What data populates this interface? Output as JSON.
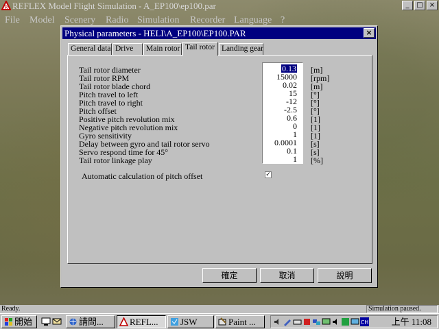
{
  "app": {
    "title": "REFLEX Model Flight Simulation - A_EP100\\ep100.par",
    "menu": [
      "File",
      "Model",
      "Scenery",
      "Radio",
      "Simulation",
      "Recorder",
      "Language",
      "?"
    ],
    "controls": {
      "minimize": "_",
      "maximize": "□",
      "close": "×"
    }
  },
  "dialog": {
    "title": "Physical parameters - HELI\\A_EP100\\EP100.PAR",
    "close": "×",
    "tabs": [
      "General data",
      "Drive",
      "Main rotor",
      "Tail rotor",
      "Landing gear"
    ],
    "active_tab": "Tail rotor",
    "parameters": [
      {
        "label": "Tail rotor diameter",
        "value": "0.13",
        "unit": "[m]",
        "selected": true
      },
      {
        "label": "Tail rotor RPM",
        "value": "15000",
        "unit": "[rpm]"
      },
      {
        "label": "Tail rotor blade chord",
        "value": "0.02",
        "unit": "[m]"
      },
      {
        "label": "Pitch travel to left",
        "value": "15",
        "unit": "[°]"
      },
      {
        "label": "Pitch travel to right",
        "value": "-12",
        "unit": "[°]"
      },
      {
        "label": "Pitch offset",
        "value": "-2.5",
        "unit": "[°]"
      },
      {
        "label": "Positive pitch revolution mix",
        "value": "0.6",
        "unit": "[1]"
      },
      {
        "label": "Negative pitch revolution mix",
        "value": "0",
        "unit": "[1]"
      },
      {
        "label": "Gyro sensitivity",
        "value": "1",
        "unit": "[1]"
      },
      {
        "label": "Delay between gyro and tail rotor servo",
        "value": "0.0001",
        "unit": "[s]"
      },
      {
        "label": "Servo respond time for 45°",
        "value": "0.1",
        "unit": "[s]"
      },
      {
        "label": "Tail rotor linkage play",
        "value": "1",
        "unit": "[%]"
      }
    ],
    "auto_calc": {
      "label": "Automatic calculation of pitch offset",
      "checked": true,
      "mark": "✓"
    },
    "buttons": {
      "ok": "確定",
      "cancel": "取消",
      "help": "說明"
    }
  },
  "statusbar": {
    "left": "Ready.",
    "right": "Simulation paused."
  },
  "taskbar": {
    "start": "開始",
    "buttons": [
      "請問...",
      "REFL...",
      "JSW",
      "Paint ..."
    ],
    "clock": "上午 11:08"
  }
}
